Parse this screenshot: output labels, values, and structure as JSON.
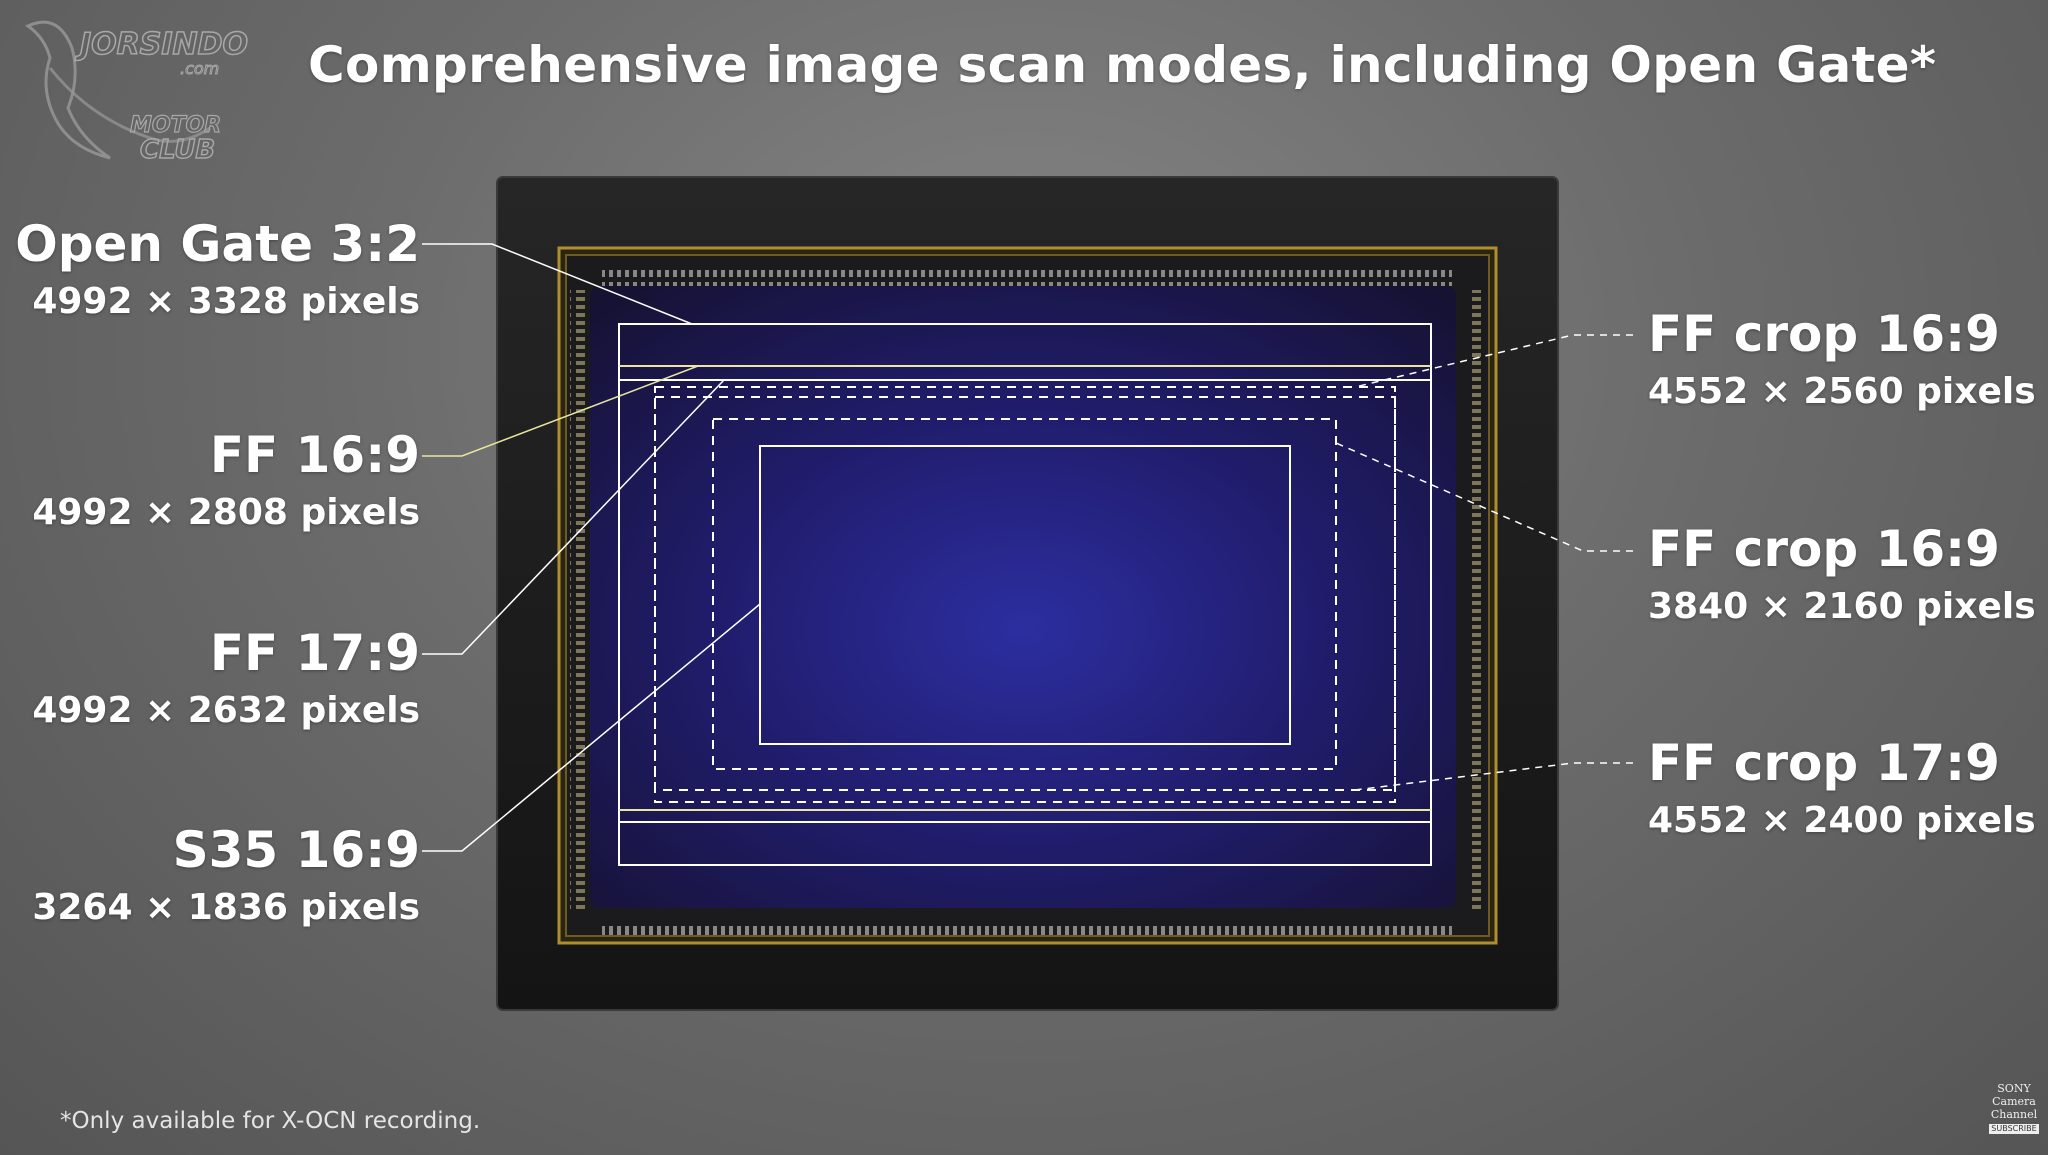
{
  "title": "Comprehensive image scan modes, including Open Gate*",
  "watermark": {
    "line1": "JORSINDO",
    "line2": ".com",
    "line3": "MOTOR",
    "line4": "CLUB"
  },
  "modes_left": [
    {
      "name": "Open Gate 3:2",
      "size": "4992 × 3328 pixels"
    },
    {
      "name": "FF 16:9",
      "size": "4992 × 2808 pixels"
    },
    {
      "name": "FF 17:9",
      "size": "4992 × 2632 pixels"
    },
    {
      "name": "S35 16:9",
      "size": "3264 × 1836 pixels"
    }
  ],
  "modes_right": [
    {
      "name": "FF crop 16:9",
      "size": "4552 × 2560 pixels"
    },
    {
      "name": "FF crop 16:9",
      "size": "3840 × 2160 pixels"
    },
    {
      "name": "FF crop 17:9",
      "size": "4552 × 2400 pixels"
    }
  ],
  "footnote": "*Only available for X-OCN recording.",
  "brand": {
    "line1": "SONY",
    "line2": "Camera",
    "line3": "Channel",
    "button": "SUBSCRIBE"
  },
  "colors": {
    "sensor_frame": "#1c1c1c",
    "sensor_gold": "#a8862c",
    "sensor_chip": "#241a55",
    "guide_white": "#ffffff",
    "guide_yellow": "#e8e6a0"
  }
}
